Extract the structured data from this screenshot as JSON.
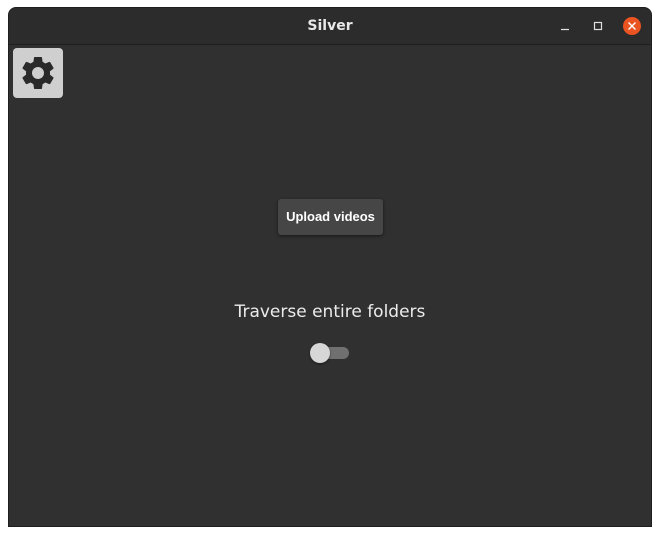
{
  "window": {
    "title": "Silver",
    "controls": {
      "minimize_icon": "minimize-icon",
      "maximize_icon": "maximize-icon",
      "close_icon": "close-icon"
    }
  },
  "toolbar": {
    "settings_icon": "gear-icon"
  },
  "main": {
    "upload_button_label": "Upload videos",
    "toggle_label": "Traverse entire folders",
    "toggle_checked": false
  },
  "colors": {
    "background": "#303030",
    "close_button": "#e95420",
    "button": "#464646"
  }
}
